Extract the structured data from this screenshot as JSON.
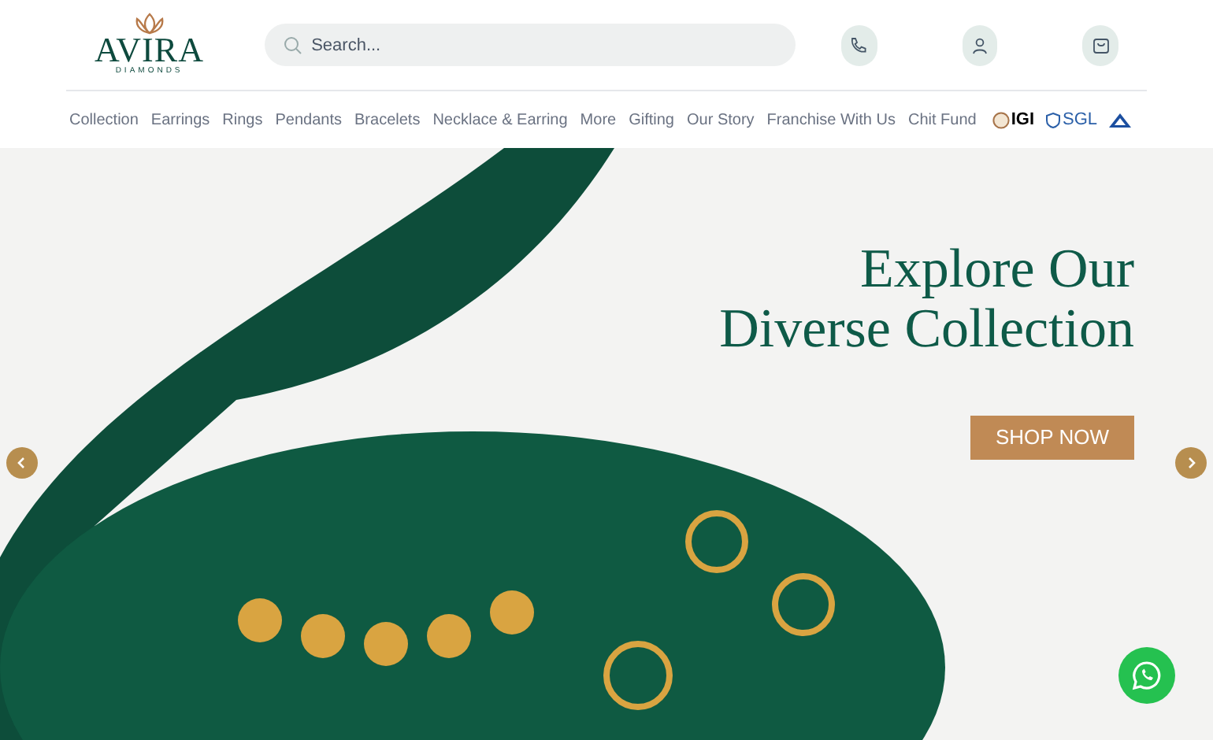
{
  "logo": {
    "name": "AVIRA",
    "tagline": "DIAMONDS"
  },
  "search": {
    "placeholder": "Search..."
  },
  "nav": [
    "Collection",
    "Earrings",
    "Rings",
    "Pendants",
    "Bracelets",
    "Necklace & Earring",
    "More",
    "Gifting",
    "Our Story",
    "Franchise With Us",
    "Chit Fund"
  ],
  "certifications": [
    {
      "kind": "igi",
      "label": "IGI"
    },
    {
      "kind": "sgl",
      "label": "SGL"
    },
    {
      "kind": "bis"
    }
  ],
  "hero": {
    "headline_lines": [
      "Explore Our",
      "Diverse Collection"
    ],
    "button": "SHOP NOW"
  }
}
